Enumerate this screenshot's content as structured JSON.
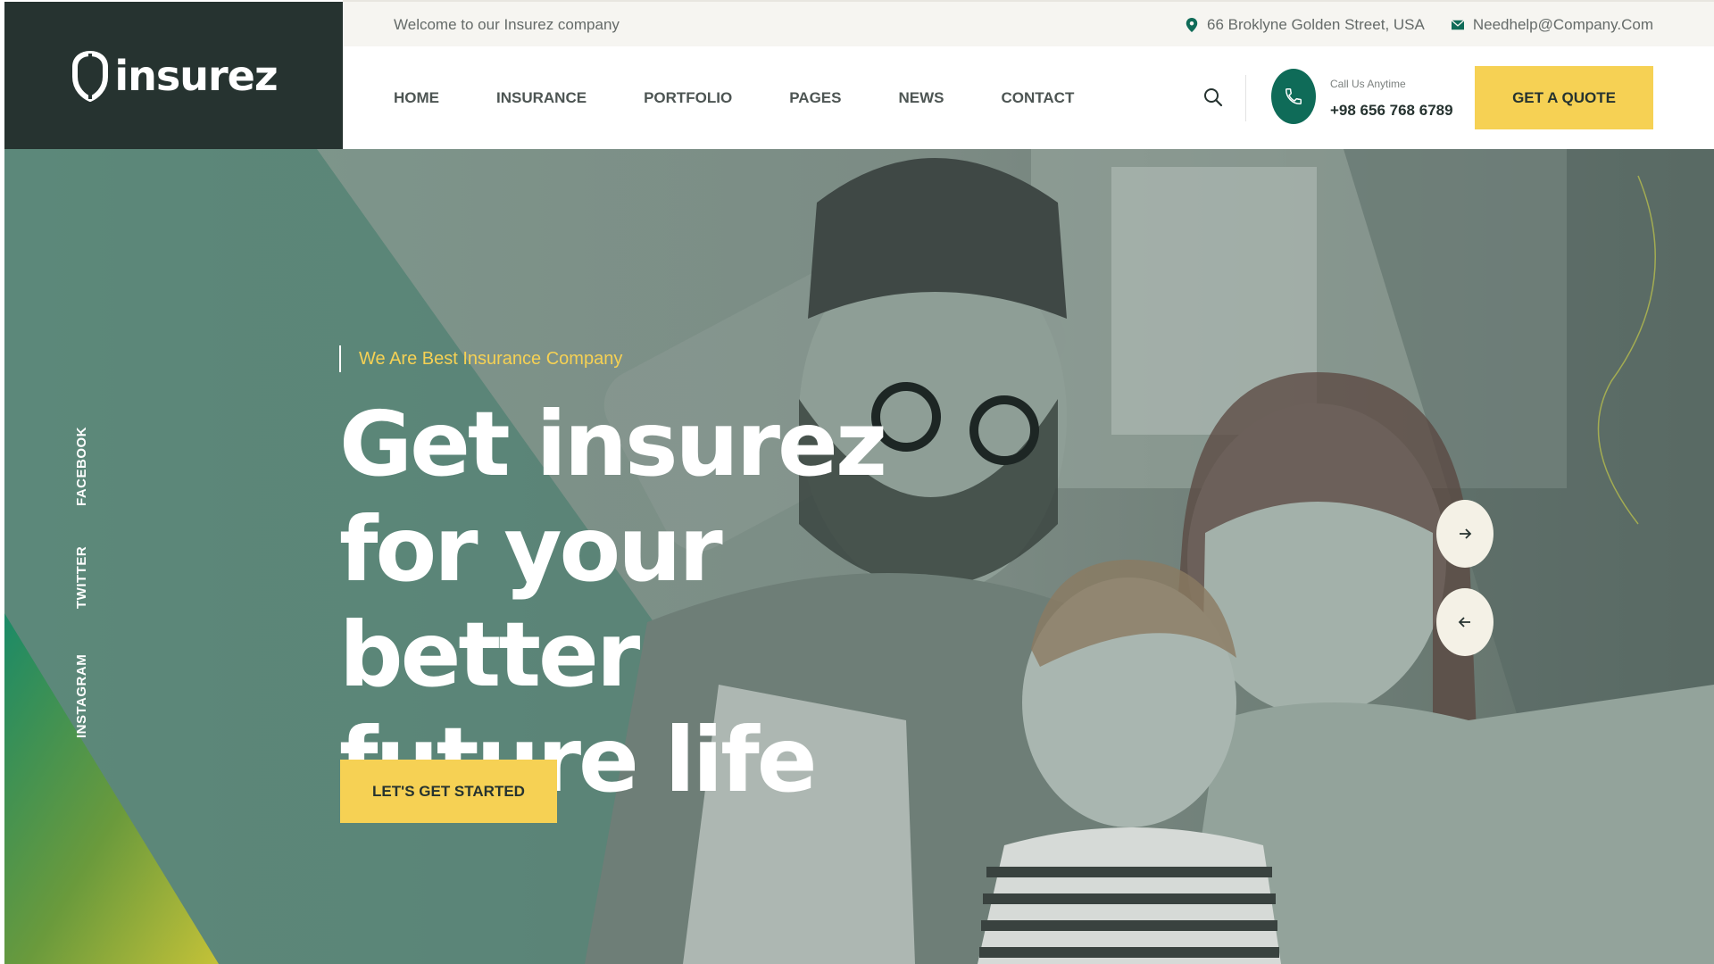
{
  "brand": {
    "name": "insurez"
  },
  "topbar": {
    "welcome": "Welcome to our Insurez company",
    "address": "66 Broklyne Golden Street, USA",
    "email": "Needhelp@Company.Com"
  },
  "nav": {
    "items": [
      {
        "label": "HOME"
      },
      {
        "label": "INSURANCE"
      },
      {
        "label": "PORTFOLIO"
      },
      {
        "label": "PAGES"
      },
      {
        "label": "NEWS"
      },
      {
        "label": "CONTACT"
      }
    ],
    "call_label": "Call Us Anytime",
    "call_number": "+98 656 768 6789",
    "quote_button": "GET A QUOTE"
  },
  "hero": {
    "tagline": "We Are Best Insurance Company",
    "headline_line1": "Get insurez",
    "headline_line2": "for your better",
    "headline_line3": "future life",
    "cta": "LET'S GET STARTED",
    "socials": [
      "FACEBOOK",
      "TWITTER",
      "INSTAGRAM"
    ]
  },
  "icons": {
    "search": "search-icon",
    "phone": "phone-icon",
    "location": "location-pin-icon",
    "email": "envelope-icon",
    "next": "arrow-right-icon",
    "prev": "arrow-left-icon"
  },
  "colors": {
    "dark": "#263330",
    "accent": "#f6d154",
    "primary_green": "#0f6b58",
    "topbar_bg": "#f6f5f1"
  }
}
